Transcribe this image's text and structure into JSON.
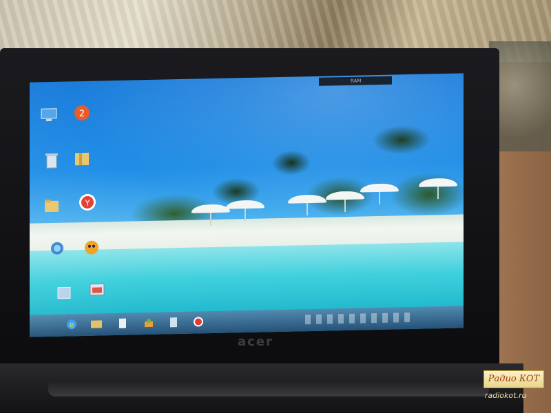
{
  "photo": {
    "subject": "netbook-screen-photo"
  },
  "laptop": {
    "brand": "acer"
  },
  "screen": {
    "wallpaper": "tropical-beach",
    "gadget": {
      "left_label": "",
      "right_label": "RAM"
    },
    "desktop_icons": [
      {
        "icon": "computer-icon",
        "label": ""
      },
      {
        "icon": "aimp-icon",
        "label": ""
      },
      {
        "icon": "recycle-bin-icon",
        "label": ""
      },
      {
        "icon": "folder-icon",
        "label": ""
      },
      {
        "icon": "folder-icon",
        "label": ""
      },
      {
        "icon": "yandex-browser-icon",
        "label": ""
      },
      {
        "icon": "network-icon",
        "label": ""
      },
      {
        "icon": "game-icon",
        "label": ""
      },
      {
        "icon": "document-icon",
        "label": ""
      },
      {
        "icon": "image-viewer-icon",
        "label": ""
      }
    ],
    "taskbar": {
      "pinned": [
        "ie-icon",
        "explorer-icon",
        "document-icon",
        "paint-icon",
        "notepad-icon",
        "yandex-browser-icon"
      ],
      "tray_language": "",
      "clock_time": "",
      "clock_date": ""
    },
    "watermark_text": ""
  },
  "watermark": {
    "title": "Радио КОТ",
    "url": "radiokot.ru"
  }
}
